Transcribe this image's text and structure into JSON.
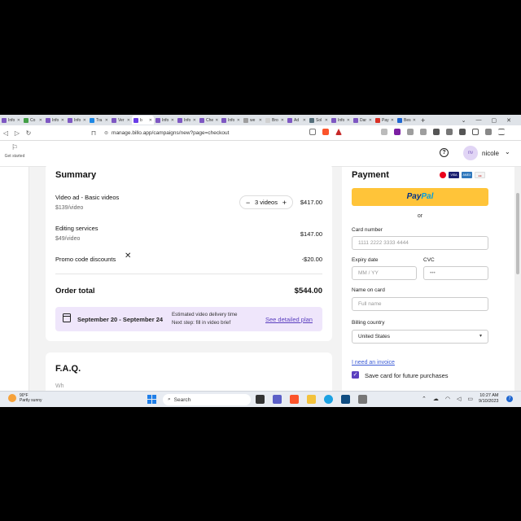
{
  "browser": {
    "tabs": [
      {
        "label": "Info",
        "color": "#7e57c2"
      },
      {
        "label": "Co",
        "color": "#43a047"
      },
      {
        "label": "Info",
        "color": "#7e57c2"
      },
      {
        "label": "Info",
        "color": "#7e57c2"
      },
      {
        "label": "Tra",
        "color": "#1e88e5"
      },
      {
        "label": "Ver",
        "color": "#7e57c2"
      },
      {
        "label": "b",
        "color": "#6a3de8",
        "active": true
      },
      {
        "label": "Info",
        "color": "#7e57c2"
      },
      {
        "label": "Info",
        "color": "#7e57c2"
      },
      {
        "label": "Che",
        "color": "#7e57c2"
      },
      {
        "label": "Info",
        "color": "#7e57c2"
      },
      {
        "label": "we",
        "color": "#9e9e9e"
      },
      {
        "label": "Bro",
        "color": "#d0d0d0"
      },
      {
        "label": "Ad",
        "color": "#7e57c2"
      },
      {
        "label": "Sol",
        "color": "#546e7a"
      },
      {
        "label": "Info",
        "color": "#7e57c2"
      },
      {
        "label": "Dar",
        "color": "#7e57c2"
      },
      {
        "label": "Pay",
        "color": "#d93025"
      },
      {
        "label": "Bes",
        "color": "#1e66d0"
      }
    ],
    "url": "manage.billo.app/campaigns/new?page=checkout"
  },
  "header": {
    "get_started": "Get started",
    "avatar_initials": "nv",
    "username": "nicole"
  },
  "summary": {
    "title": "Summary",
    "items": [
      {
        "title": "Video ad - Basic videos",
        "sub": "$139/video",
        "price": "$417.00"
      },
      {
        "title": "Editing services",
        "sub": "$49/video",
        "price": "$147.00"
      },
      {
        "title": "Promo code discounts",
        "price": "-$20.00"
      }
    ],
    "quantity": "3 videos",
    "total_label": "Order total",
    "total_value": "$544.00",
    "delivery": {
      "dates": "September 20 - September 24",
      "line1": "Estimated video delivery time",
      "line2": "Next step: fill in video brief",
      "link": "See detailed plan"
    }
  },
  "faq": {
    "title": "F.A.Q.",
    "peek": "Wh                    "
  },
  "payment": {
    "title": "Payment",
    "paypal_1": "Pay",
    "paypal_2": "Pal",
    "or": "or",
    "card_number_label": "Card number",
    "card_number_placeholder": "1111 2222 3333 4444",
    "expiry_label": "Expiry date",
    "expiry_placeholder": "MM / YY",
    "cvc_label": "CVC",
    "cvc_placeholder": "•••",
    "name_label": "Name on card",
    "name_placeholder": "Full name",
    "country_label": "Billing country",
    "country_value": "United States",
    "invoice_link": "I need an invoice",
    "save_card_label": "Save card for future purchases",
    "save_card_checked": true
  },
  "taskbar": {
    "temp": "90°F",
    "weather": "Partly sunny",
    "search_placeholder": "Search",
    "time": "10:27 AM",
    "date": "9/10/2023",
    "notifications": "7"
  }
}
